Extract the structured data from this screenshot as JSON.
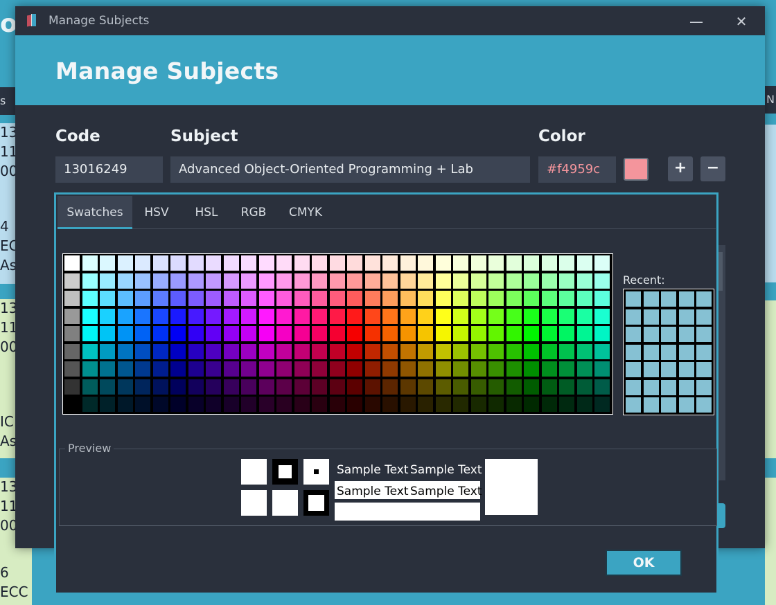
{
  "background": {
    "logo_letter": "o",
    "header_left": "s",
    "header_right": "N",
    "cards": [
      {
        "color": "blue",
        "lines": [
          "13",
          "11",
          "00",
          "",
          "4",
          "EC",
          "As"
        ]
      },
      {
        "color": "green",
        "lines": [
          "13",
          "11",
          "00",
          "",
          "",
          "IC",
          "As"
        ]
      },
      {
        "color": "green",
        "lines": [
          "13",
          "11",
          "00",
          "",
          "6",
          "ECC"
        ]
      }
    ]
  },
  "dialog": {
    "window_title": "Manage Subjects",
    "heading": "Manage Subjects",
    "minimize_glyph": "—",
    "close_glyph": "✕",
    "labels": {
      "code": "Code",
      "subject": "Subject",
      "color": "Color"
    },
    "code_value": "13016249",
    "subject_value": "Advanced Object-Oriented Programming + Lab",
    "color_value": "#f4959c",
    "add_label": "+",
    "remove_label": "−"
  },
  "chooser": {
    "tabs": [
      "Swatches",
      "HSV",
      "HSL",
      "RGB",
      "CMYK"
    ],
    "active_tab": "Swatches",
    "recent_label": "Recent:",
    "recent_color": "#86c1d3",
    "preview_label": "Preview",
    "sample_text": "Sample Text",
    "ok_label": "OK"
  }
}
